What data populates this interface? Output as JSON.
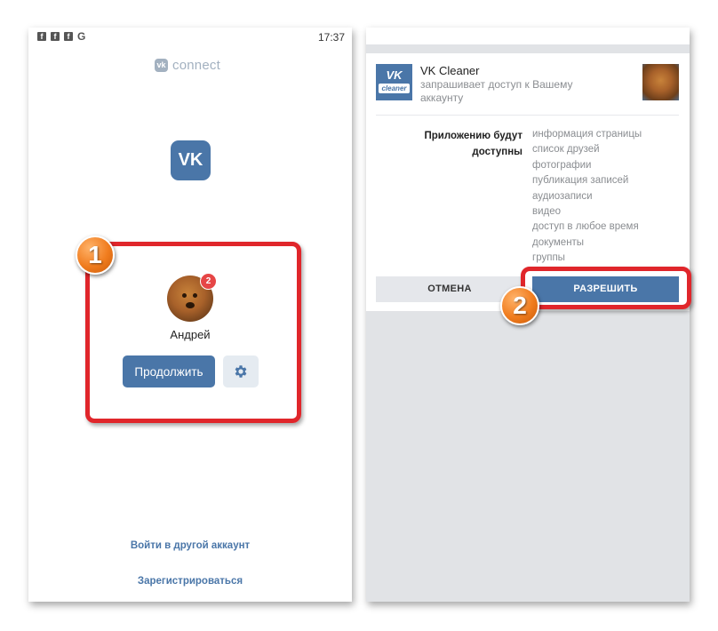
{
  "colors": {
    "vk_blue": "#4a76a8",
    "highlight_red": "#e0262b",
    "step_orange": "#f07c1e",
    "badge_red": "#e64646"
  },
  "left_screen": {
    "status_bar": {
      "icons": [
        "facebook-icon",
        "facebook-icon",
        "facebook-icon",
        "google-icon"
      ],
      "g_glyph": "G",
      "time": "17:37"
    },
    "brand": {
      "logo_glyph": "vk",
      "text": "connect"
    },
    "vk_logo_glyph": "VK",
    "account": {
      "name": "Андрей",
      "notification_count": "2"
    },
    "continue_button": "Продолжить",
    "settings_icon": "gear-icon",
    "other_account_link": "Войти в другой аккаунт",
    "register_link": "Зарегистрироваться"
  },
  "right_screen": {
    "app": {
      "logo_main": "VK",
      "logo_sub": "cleaner",
      "name": "VK Cleaner",
      "request_text": "запрашивает доступ к Вашему аккаунту"
    },
    "permissions_label": "Приложению будут доступны",
    "permissions": [
      "информация страницы",
      "список друзей",
      "фотографии",
      "публикация записей",
      "аудиозаписи",
      "видео",
      "доступ в любое время",
      "документы",
      "группы"
    ],
    "cancel_button": "ОТМЕНА",
    "allow_button": "РАЗРЕШИТЬ"
  },
  "annotations": {
    "step1": "1",
    "step2": "2"
  }
}
